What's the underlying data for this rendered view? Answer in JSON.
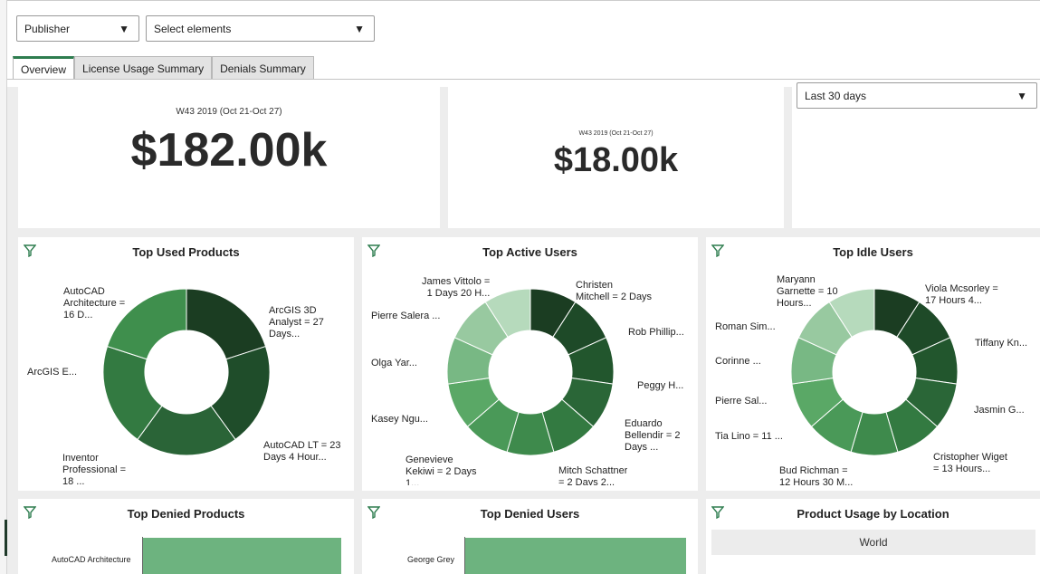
{
  "filters": {
    "publisher": "Publisher",
    "elements": "Select elements",
    "range": "Last 30 days"
  },
  "tabs": [
    {
      "label": "Overview",
      "active": true
    },
    {
      "label": "License Usage Summary",
      "active": false
    },
    {
      "label": "Denials Summary",
      "active": false
    }
  ],
  "kpis": [
    {
      "sub": "W43 2019 (Oct 21-Oct 27)",
      "value": "$182.00k"
    },
    {
      "sub": "W43 2019 (Oct 21-Oct 27)",
      "value": "$18.00k"
    }
  ],
  "panels": {
    "used_products": {
      "title": "Top Used Products",
      "labels": [
        "AutoCAD\nArchitecture =\n16 D...",
        "ArcGIS 3D\nAnalyst = 27\nDays...",
        "ArcGIS E...",
        "AutoCAD LT = 23\nDays 4 Hour...",
        "Inventor\nProfessional =\n18 ..."
      ]
    },
    "active_users": {
      "title": "Top Active Users",
      "labels": [
        "James Vittolo =\n1 Days 20 H...",
        "Christen\nMitchell = 2 Days",
        "Pierre Salera ...",
        "Rob Phillip...",
        "Olga Yar...",
        "Peggy H...",
        "Kasey Ngu...",
        "Eduardo\nBellendir = 2\nDays ...",
        "Genevieve\nKekiwi = 2 Days\n1...",
        "Mitch Schattner\n= 2 Days 2..."
      ]
    },
    "idle_users": {
      "title": "Top Idle Users",
      "labels": [
        "Maryann\nGarnette = 10\nHours...",
        "Viola Mcsorley =\n17 Hours 4...",
        "Roman Sim...",
        "Tiffany Kn...",
        "Corinne ...",
        "Pierre Sal...",
        "Jasmin G...",
        "Tia Lino = 11 ...",
        "Cristopher Wiget\n= 13 Hours...",
        "Bud Richman =\n12 Hours 30 M..."
      ]
    },
    "denied_products": {
      "title": "Top Denied Products",
      "bar_label": "AutoCAD Architecture"
    },
    "denied_users": {
      "title": "Top Denied Users",
      "bar_label": "George Grey"
    },
    "location": {
      "title": "Product Usage by Location",
      "region": "World"
    }
  },
  "icons": {
    "filter": "filter-funnel-icon",
    "caret": "caret-down-icon"
  },
  "colors": {
    "accent": "#2e7d4f",
    "bar": "#6db37f"
  },
  "donuts": {
    "used": [
      "#1b3d22",
      "#1f4d2a",
      "#2a6437",
      "#337a41",
      "#3f8f4d"
    ],
    "active": [
      "#1b3d22",
      "#1e4a28",
      "#22562d",
      "#2a6637",
      "#337a41",
      "#3e8a4c",
      "#4a9958",
      "#5aa866",
      "#78b884",
      "#98c9a0",
      "#b6dabc"
    ],
    "idle": [
      "#1b3d22",
      "#1e4a28",
      "#22562d",
      "#2a6637",
      "#337a41",
      "#3e8a4c",
      "#4a9958",
      "#5aa866",
      "#78b884",
      "#98c9a0",
      "#b6dabc"
    ]
  }
}
